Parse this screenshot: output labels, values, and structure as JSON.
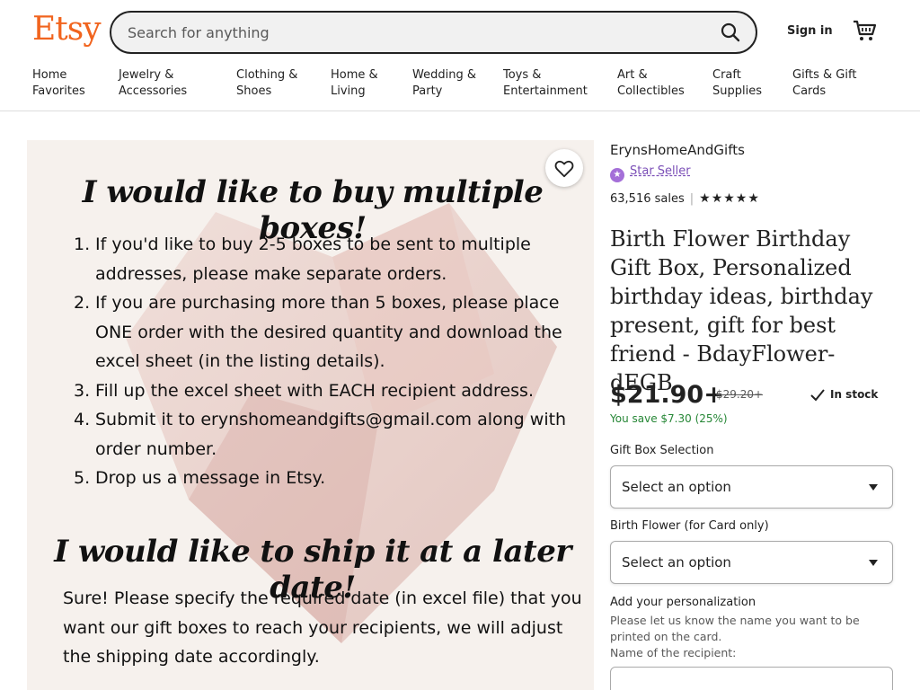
{
  "header": {
    "logo": "Etsy",
    "search_placeholder": "Search for anything",
    "sign_in": "Sign in"
  },
  "nav": [
    {
      "l1": "Home",
      "l2": "Favorites"
    },
    {
      "l1": "Jewelry &",
      "l2": "Accessories"
    },
    {
      "l1": "Clothing &",
      "l2": "Shoes"
    },
    {
      "l1": "Home &",
      "l2": "Living"
    },
    {
      "l1": "Wedding &",
      "l2": "Party"
    },
    {
      "l1": "Toys &",
      "l2": "Entertainment"
    },
    {
      "l1": "Art &",
      "l2": "Collectibles"
    },
    {
      "l1": "Craft",
      "l2": "Supplies"
    },
    {
      "l1": "Gifts & Gift",
      "l2": "Cards"
    }
  ],
  "image": {
    "heading1": "I would like to buy multiple boxes!",
    "items": [
      {
        "n": "1.",
        "t": "If you'd like to buy 2-5 boxes to be sent to multiple addresses, please make separate orders."
      },
      {
        "n": "2.",
        "t": "If you are purchasing more than 5 boxes, please place ONE order with the desired quantity and download the excel sheet (in the listing details)."
      },
      {
        "n": "3.",
        "t": "Fill up the excel sheet with EACH recipient address."
      },
      {
        "n": "4.",
        "t": "Submit it to erynshomeandgifts@gmail.com along with order number."
      },
      {
        "n": "5.",
        "t": "Drop us a message in Etsy."
      }
    ],
    "heading2": "I would like to ship it at a later date!",
    "paragraph": "Sure! Please specify the required date (in excel file) that you want our gift boxes to reach your recipients, we will adjust the shipping date accordingly."
  },
  "listing": {
    "shop_name": "ErynsHomeAndGifts",
    "star_seller": "Star Seller",
    "sales": "63,516 sales",
    "rating_stars": "★★★★★",
    "title": "Birth Flower Birthday Gift Box, Personalized birthday ideas, birthday present, gift for best friend - BdayFlower-dEGB",
    "price": "$21.90+",
    "original_price": "$29.20+",
    "stock": "In stock",
    "savings": "You save $7.30 (25%)",
    "option1_label": "Gift Box Selection",
    "option1_value": "Select an option",
    "option2_label": "Birth Flower (for Card only)",
    "option2_value": "Select an option",
    "personalization_title": "Add your personalization",
    "personalization_text1": "Please let us know the name you want to be printed on the card.",
    "personalization_text2": "Name of the recipient:"
  },
  "colors": {
    "brand": "#f1641e",
    "star_seller": "#7b4fb7",
    "savings": "#258635"
  }
}
